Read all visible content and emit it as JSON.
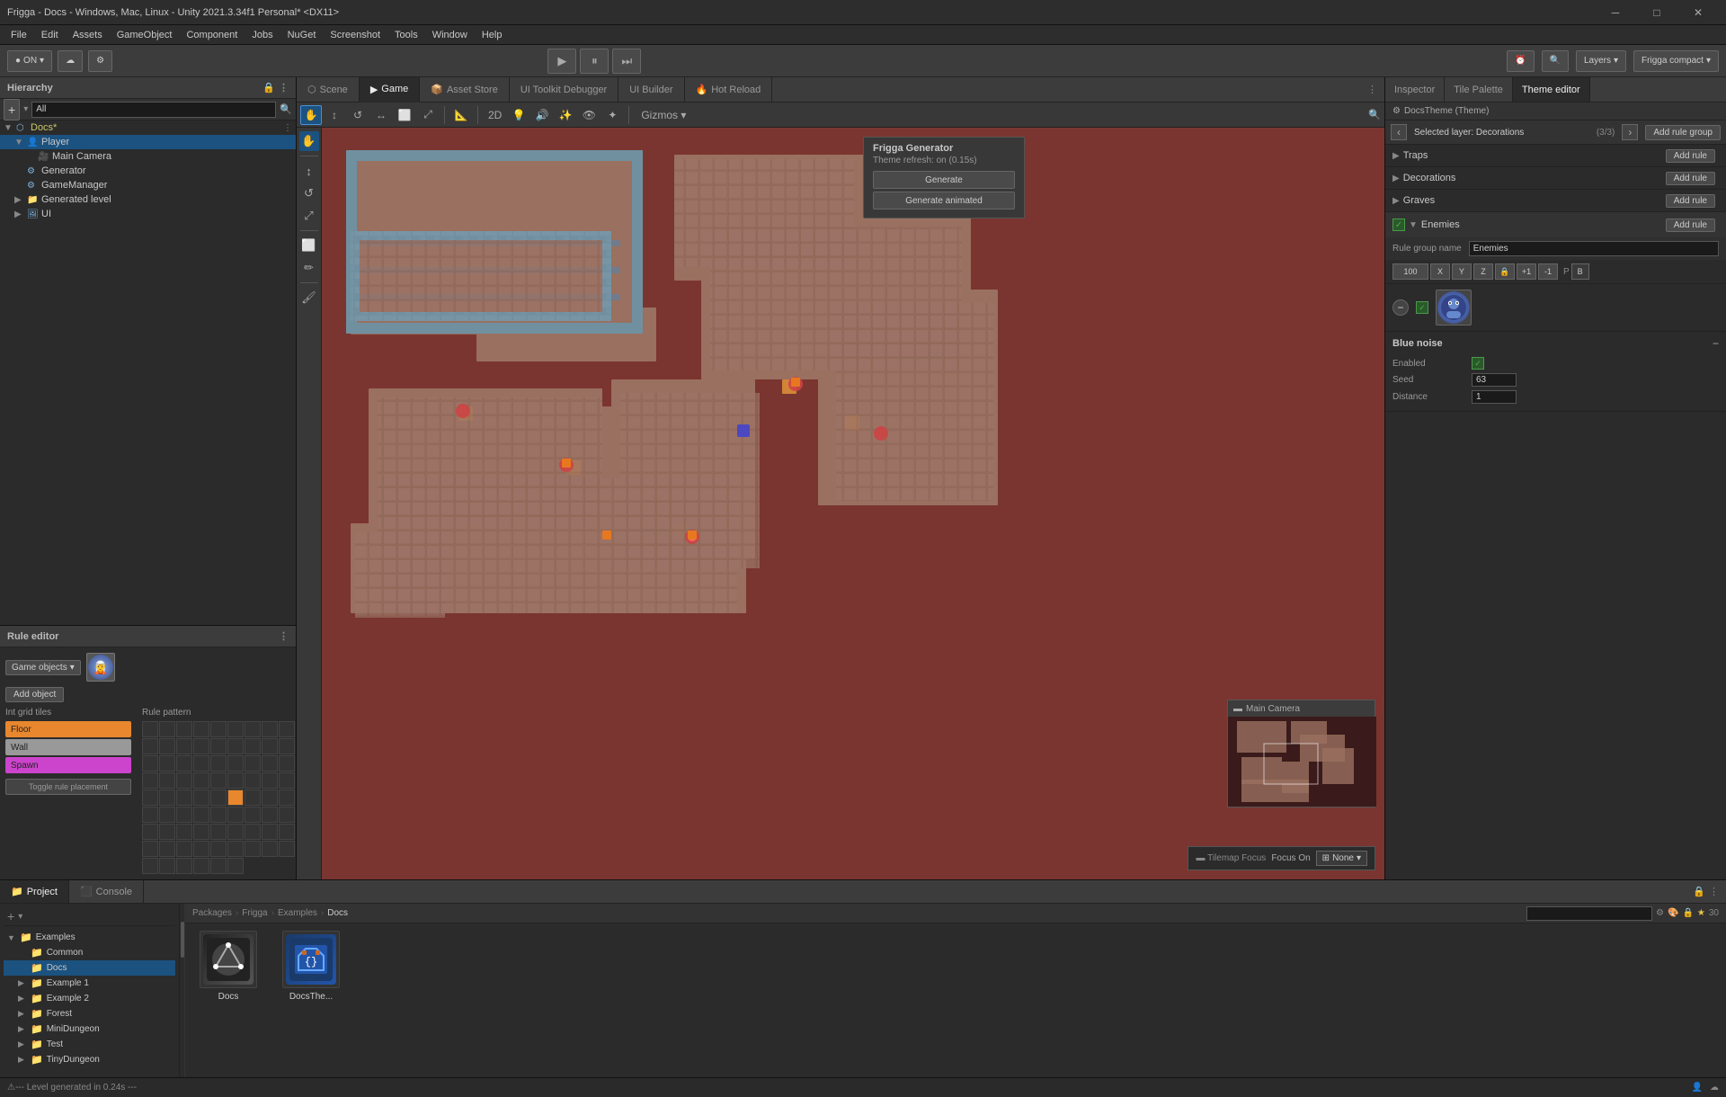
{
  "window": {
    "title": "Frigga - Docs - Windows, Mac, Linux - Unity 2021.3.34f1 Personal* <DX11>",
    "controls": [
      "─",
      "□",
      "✕"
    ]
  },
  "menubar": {
    "items": [
      "File",
      "Edit",
      "Assets",
      "GameObject",
      "Component",
      "Jobs",
      "NuGet",
      "Screenshot",
      "Tools",
      "Window",
      "Help"
    ]
  },
  "toolbar": {
    "env_btn": "ON",
    "cloud_btn": "☁",
    "settings_btn": "⚙",
    "play_btn": "▶",
    "pause_btn": "⏸",
    "step_btn": "⏭",
    "layers_btn": "Layers",
    "layout_btn": "Frigga compact",
    "search_icon": "🔍",
    "collab_icon": "⚙"
  },
  "tabs": {
    "scene": "Scene",
    "game": "Game",
    "asset_store": "Asset Store",
    "ui_toolkit": "UI Toolkit Debugger",
    "ui_builder": "UI Builder",
    "hot_reload": "Hot Reload"
  },
  "inspector_tabs": {
    "inspector": "Inspector",
    "tile_palette": "Tile Palette",
    "theme_editor": "Theme editor"
  },
  "hierarchy": {
    "title": "Hierarchy",
    "search_placeholder": "All",
    "items": [
      {
        "label": "Docs*",
        "level": 0,
        "has_children": true,
        "icon": "📄",
        "modified": true
      },
      {
        "label": "Player",
        "level": 1,
        "has_children": true,
        "icon": "👤",
        "selected": true
      },
      {
        "label": "Main Camera",
        "level": 2,
        "has_children": false,
        "icon": "🎥"
      },
      {
        "label": "Generator",
        "level": 1,
        "has_children": false,
        "icon": "⚙"
      },
      {
        "label": "GameManager",
        "level": 1,
        "has_children": false,
        "icon": "⚙"
      },
      {
        "label": "Generated level",
        "level": 1,
        "has_children": true,
        "icon": "📁"
      },
      {
        "label": "UI",
        "level": 1,
        "has_children": true,
        "icon": "🖼"
      }
    ]
  },
  "rule_editor": {
    "title": "Rule editor",
    "game_objects_label": "Game objects",
    "add_object_label": "Add object",
    "int_grid_tiles_label": "Int grid tiles",
    "rule_pattern_label": "Rule pattern",
    "tiles": [
      "Floor",
      "Wall",
      "Spawn"
    ],
    "toggle_btn": "Toggle rule placement"
  },
  "scene_toolbar": {
    "tools": [
      "✋",
      "↕",
      "↔",
      "⟲",
      "⤢",
      "⬜",
      "📐"
    ],
    "modes": [
      "2D",
      "💡",
      "🔊",
      "🎮",
      "🔧"
    ],
    "gizmo_btn": "Gizmos ▼"
  },
  "generator_popup": {
    "title": "Frigga Generator",
    "subtitle": "Theme refresh: on (0.15s)",
    "generate_btn": "Generate",
    "generate_animated_btn": "Generate animated"
  },
  "mini_camera": {
    "title": "Main Camera"
  },
  "tilemap_focus": {
    "label": "Tilemap Focus",
    "focus_on": "Focus On",
    "none_option": "None"
  },
  "inspector": {
    "title": "DocsTheme (Theme)",
    "selected_layer": "Selected layer: Decorations",
    "layer_count": "(3/3)",
    "add_rule_group_btn": "Add rule group",
    "nav_left": "‹",
    "nav_right": "›",
    "sections": [
      {
        "label": "Traps",
        "add_rule_label": "Add rule"
      },
      {
        "label": "Decorations",
        "add_rule_label": "Add rule"
      },
      {
        "label": "Graves",
        "add_rule_label": "Add rule"
      },
      {
        "label": "Enemies",
        "add_rule_label": "Add rule",
        "enabled": true
      }
    ],
    "rule_group_name_label": "Rule group name",
    "rule_group_name_value": "Enemies",
    "transform_labels": [
      "100",
      "X",
      "Y",
      "Z",
      "P",
      "B"
    ],
    "blue_noise": {
      "title": "Blue noise",
      "enabled_label": "Enabled",
      "enabled": true,
      "seed_label": "Seed",
      "seed_value": "63",
      "distance_label": "Distance",
      "distance_value": "1"
    }
  },
  "bottom_panel": {
    "tabs": [
      "Project",
      "Console"
    ],
    "project_tab_active": true
  },
  "project": {
    "breadcrumb": [
      "Packages",
      "Frigga",
      "Examples",
      "Docs"
    ],
    "search_placeholder": "",
    "tree": [
      {
        "label": "Examples",
        "level": 0,
        "has_children": true,
        "icon": "folder"
      },
      {
        "label": "Common",
        "level": 1,
        "icon": "folder"
      },
      {
        "label": "Docs",
        "level": 1,
        "icon": "folder",
        "selected": true
      },
      {
        "label": "Example 1",
        "level": 1,
        "has_children": true,
        "icon": "folder"
      },
      {
        "label": "Example 2",
        "level": 1,
        "has_children": true,
        "icon": "folder"
      },
      {
        "label": "Forest",
        "level": 1,
        "has_children": true,
        "icon": "folder"
      },
      {
        "label": "MiniDungeon",
        "level": 1,
        "has_children": true,
        "icon": "folder"
      },
      {
        "label": "Test",
        "level": 1,
        "has_children": true,
        "icon": "folder"
      },
      {
        "label": "TinyDungeon",
        "level": 1,
        "has_children": true,
        "icon": "folder"
      }
    ],
    "assets": [
      {
        "label": "Docs",
        "type": "unity"
      },
      {
        "label": "DocsThe...",
        "type": "frigga"
      }
    ]
  },
  "statusbar": {
    "message": "--- Level generated in 0.24s ---"
  },
  "icons": {
    "unity_logo": "U",
    "docs_asset": "📄",
    "frigga_asset": "{}",
    "search": "🔍",
    "star": "★",
    "thirty": "30"
  }
}
